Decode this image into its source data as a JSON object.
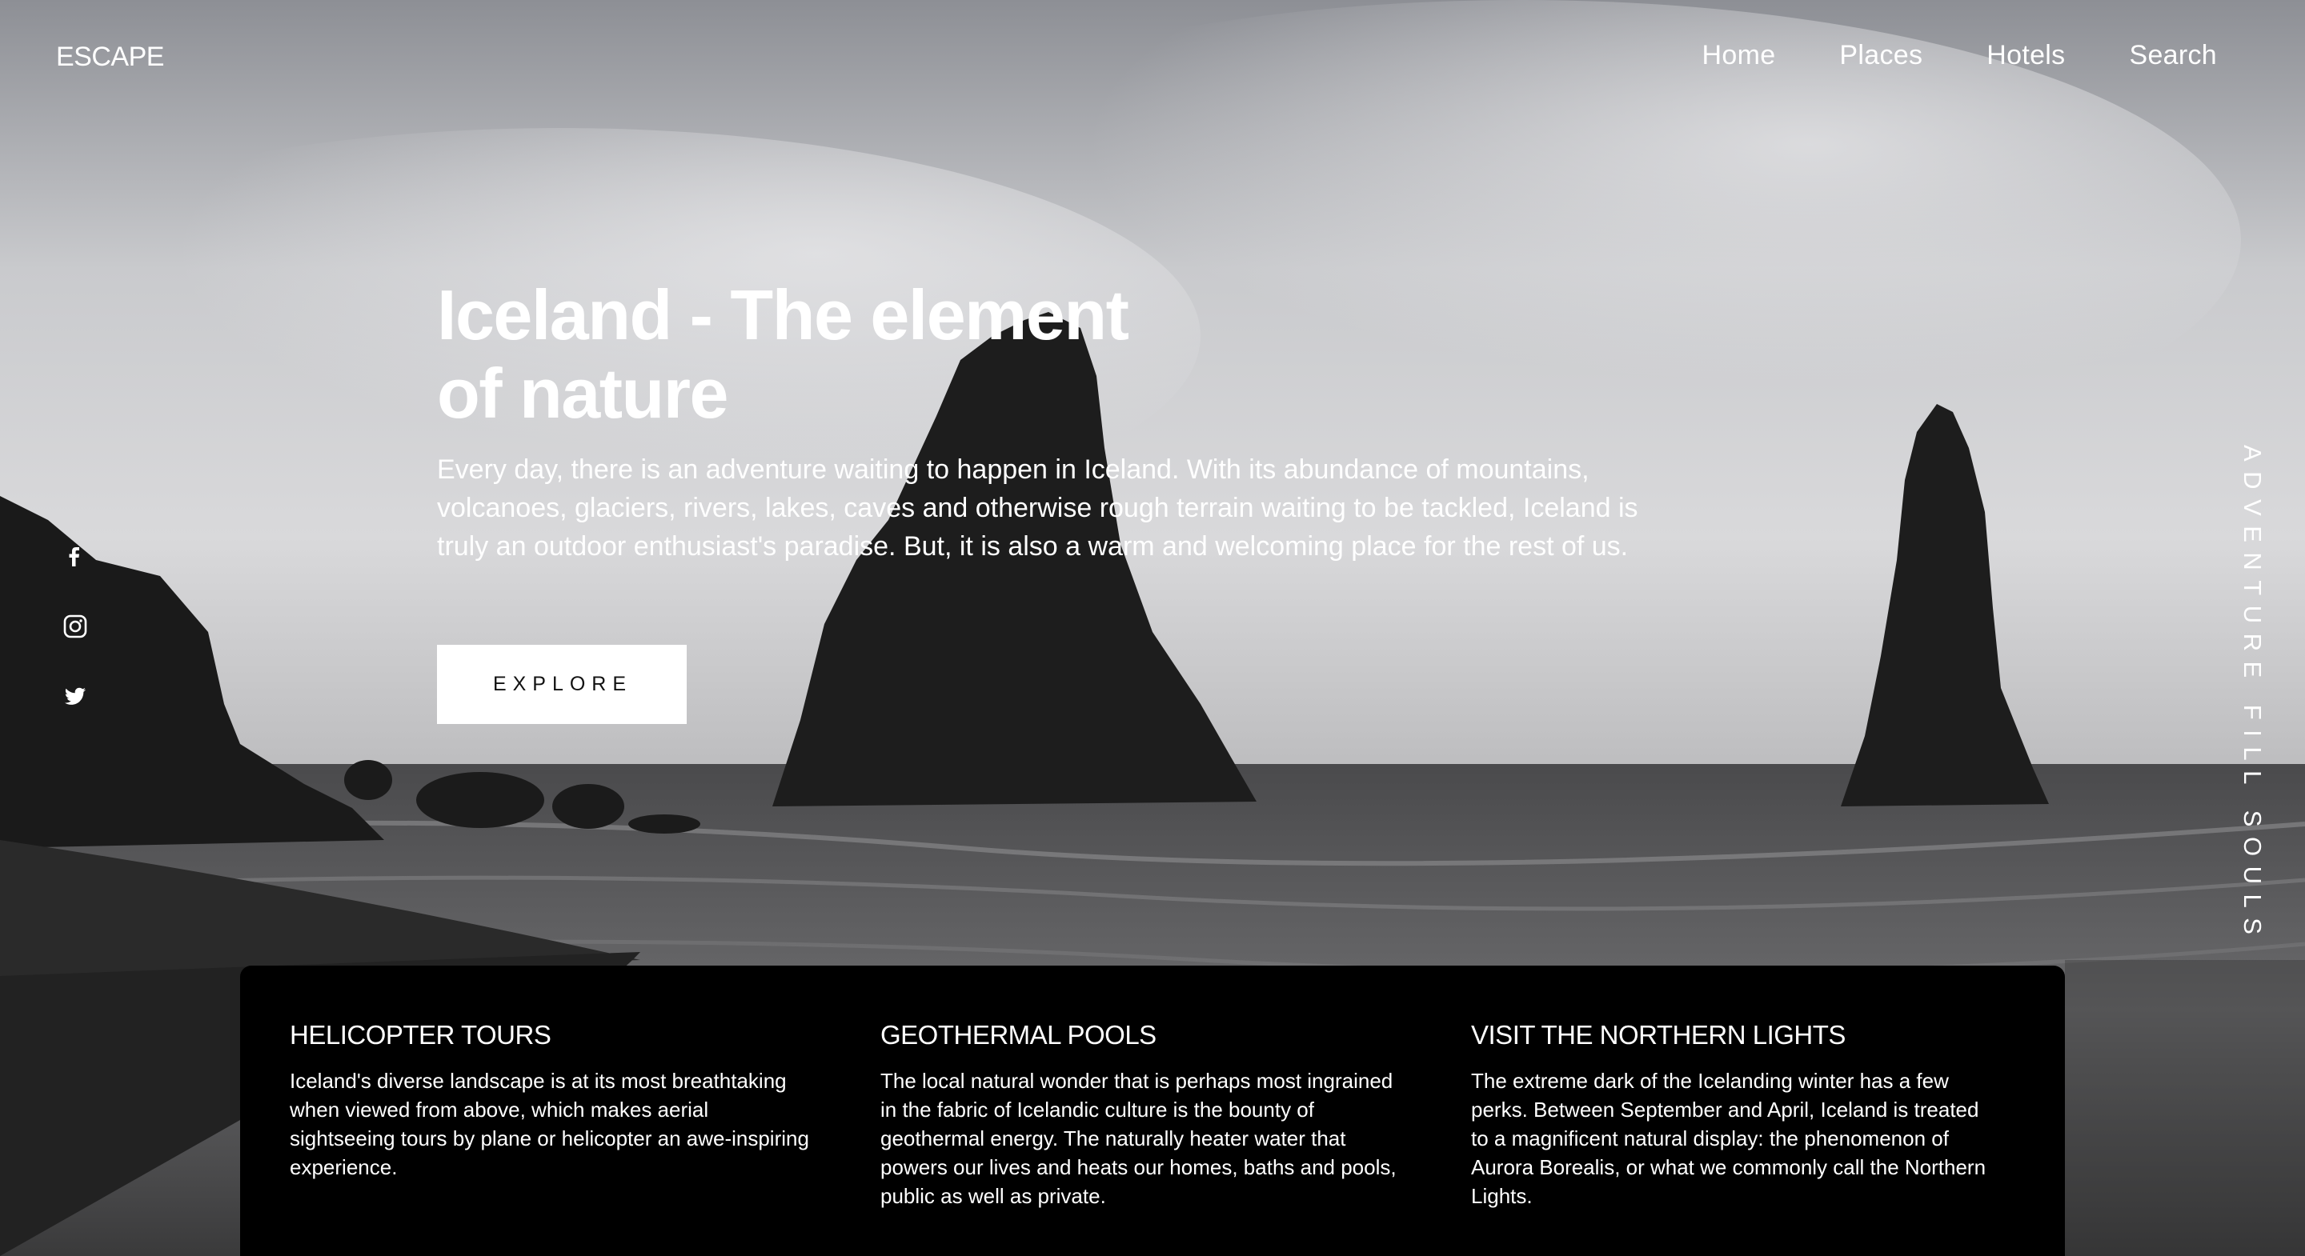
{
  "header": {
    "logo": "ESCAPE",
    "nav": [
      "Home",
      "Places",
      "Hotels",
      "Search"
    ]
  },
  "social": {
    "icons": [
      "facebook-icon",
      "instagram-icon",
      "twitter-icon"
    ]
  },
  "hero": {
    "title": "Iceland - The element of nature",
    "description": "Every day, there is an adventure waiting to happen in Iceland. With its abundance of mountains, volcanoes, glaciers, rivers, lakes, caves and otherwise rough terrain waiting to be tackled, Iceland is truly an outdoor enthusiast's paradise. But, it is also a warm and welcoming place for the rest of us.",
    "button": "EXPLORE"
  },
  "tagline": "ADVENTURE FILL SOULS",
  "features": [
    {
      "title": "HELICOPTER TOURS",
      "text": "Iceland's diverse landscape is at its most breathtaking when viewed from above, which makes aerial sightseeing tours by plane or helicopter an awe-inspiring experience."
    },
    {
      "title": "GEOTHERMAL POOLS",
      "text": "The local natural wonder that is perhaps most ingrained in the fabric of Icelandic culture is the bounty of geothermal energy. The naturally heater water that powers our lives and heats our homes, baths and pools, public as well as private."
    },
    {
      "title": "VISIT THE NORTHERN LIGHTS",
      "text": "The extreme dark of the Icelanding winter has a few perks. Between September and April, Iceland is treated to a magnificent natural display: the phenomenon of Aurora Borealis, or what we commonly call the Northern Lights."
    }
  ],
  "colors": {
    "panel": "#000000",
    "button_bg": "#ffffff",
    "text": "#ffffff"
  }
}
